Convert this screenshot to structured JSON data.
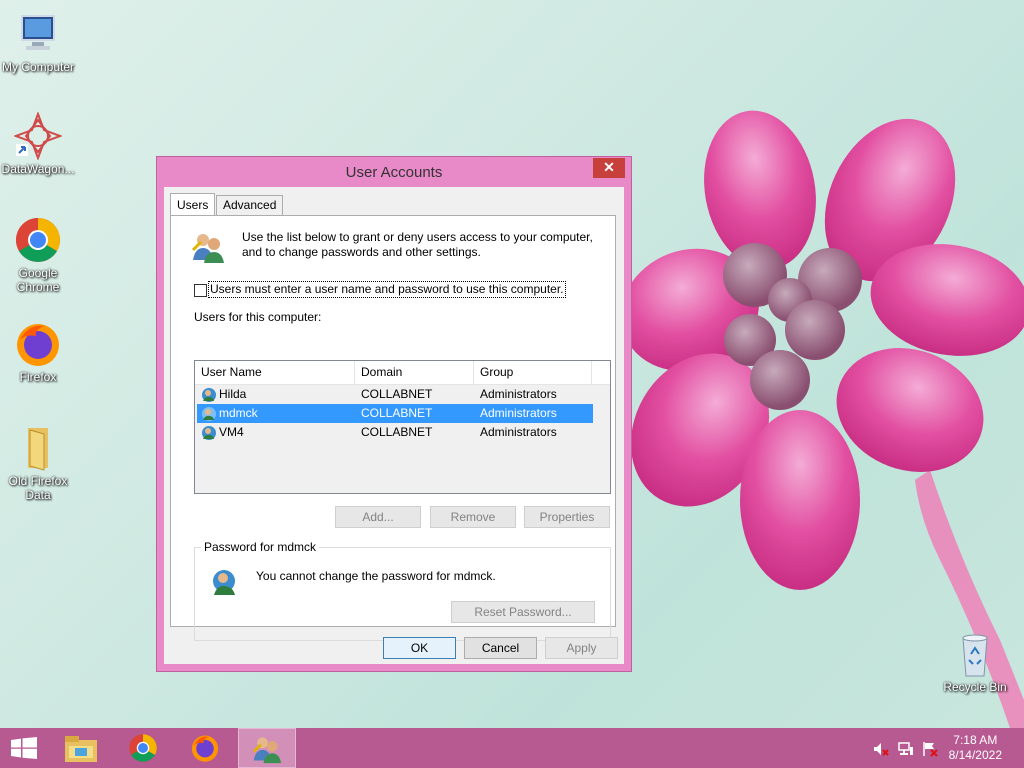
{
  "desktop": {
    "icons": [
      {
        "label": "My Computer"
      },
      {
        "label": "DataWagon..."
      },
      {
        "label": "Google Chrome"
      },
      {
        "label": "Firefox"
      },
      {
        "label": "Old Firefox Data"
      },
      {
        "label": "Recycle Bin"
      }
    ]
  },
  "window": {
    "title": "User Accounts",
    "close_glyph": "✕",
    "tabs": [
      {
        "label": "Users"
      },
      {
        "label": "Advanced"
      }
    ],
    "intro_text": "Use the list below to grant or deny users access to your computer, and to change passwords and other settings.",
    "require_login_label": "Users must enter a user name and password to use this computer.",
    "require_login_checked": false,
    "users_label": "Users for this computer:",
    "columns": [
      "User Name",
      "Domain",
      "Group"
    ],
    "users": [
      {
        "name": "Hilda",
        "domain": "COLLABNET",
        "group": "Administrators",
        "selected": false
      },
      {
        "name": "mdmck",
        "domain": "COLLABNET",
        "group": "Administrators",
        "selected": true
      },
      {
        "name": "VM4",
        "domain": "COLLABNET",
        "group": "Administrators",
        "selected": false
      }
    ],
    "buttons": {
      "add": "Add...",
      "remove": "Remove",
      "properties": "Properties"
    },
    "password_group": {
      "title": "Password for mdmck",
      "message": "You cannot change the password for mdmck.",
      "reset_button": "Reset Password..."
    },
    "footer": {
      "ok": "OK",
      "cancel": "Cancel",
      "apply": "Apply"
    }
  },
  "taskbar": {
    "items": [
      {
        "icon": "start-windows-icon"
      },
      {
        "icon": "file-explorer-icon"
      },
      {
        "icon": "chrome-icon"
      },
      {
        "icon": "firefox-icon"
      },
      {
        "icon": "user-accounts-icon",
        "active": true
      }
    ],
    "tray": [
      {
        "icon": "volume-muted-icon"
      },
      {
        "icon": "network-icon"
      },
      {
        "icon": "action-center-flag-icon"
      }
    ],
    "time": "7:18 AM",
    "date": "8/14/2022"
  },
  "colors": {
    "accent": "#e889c8",
    "taskbar": "#b65a91",
    "selection": "#3399ff",
    "close": "#c7403b"
  }
}
